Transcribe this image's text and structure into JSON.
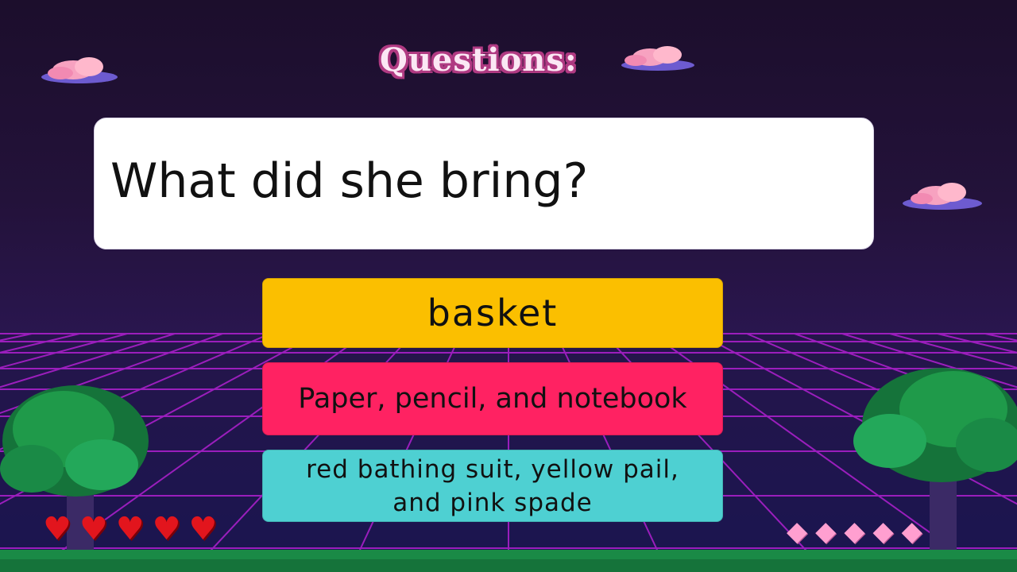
{
  "title": "Questions:",
  "question": "What did she bring?",
  "answers": [
    {
      "label": "basket",
      "color": "#fbbf00"
    },
    {
      "label": "Paper, pencil, and notebook",
      "color": "#ff2262"
    },
    {
      "label": "red  bathing suit, yellow pail, and pink spade",
      "color": "#4ed0d2"
    }
  ],
  "hud": {
    "lives": 5,
    "life_icon": "heart-icon",
    "gems": 5,
    "gem_icon": "diamond-icon"
  },
  "colors": {
    "background": "#22123a",
    "grid": "#b020d0",
    "tree_leaves": "#1f9a4a",
    "cloud": "#f7a2c0"
  }
}
